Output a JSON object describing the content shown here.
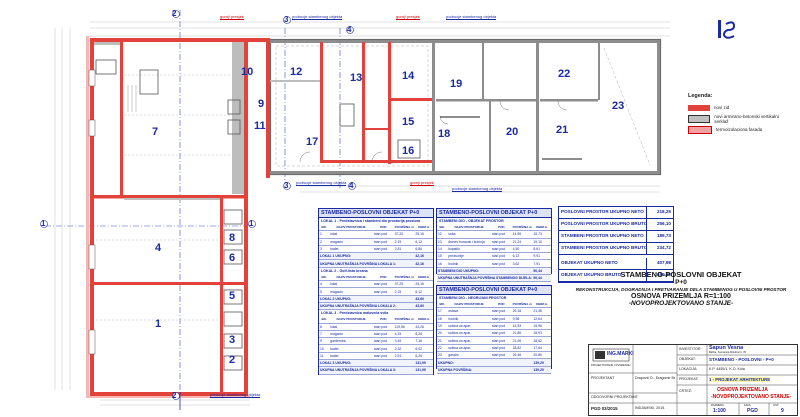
{
  "plan": {
    "rooms": [
      "1",
      "2",
      "3",
      "4",
      "5",
      "6",
      "7",
      "8",
      "9",
      "10",
      "11",
      "12",
      "13",
      "14",
      "15",
      "16",
      "17",
      "18",
      "19",
      "20",
      "21",
      "22",
      "23"
    ],
    "axis_labels": {
      "a2_top": "2",
      "a2_bottom": "2",
      "a1_left": "1",
      "a1_right": "1",
      "a3_top": "3",
      "a4_top": "4",
      "a3_mid": "3",
      "a4_mid": "4"
    },
    "tags": {
      "top1": "gornji presjek",
      "top2": "podrucje stambenog objekta",
      "top3": "gornji presjek",
      "top4": "podrucje stambenog objekta",
      "bot1": "podrucje stambenog objekta",
      "bot2": "gornji presjek",
      "bot3": "podrucje stambenog objekta",
      "left1": "podrucje stambenog objekta"
    }
  },
  "legend": {
    "title": "Legenda:",
    "items": [
      {
        "label": "novi zid",
        "color": "#e3423a"
      },
      {
        "label": "novi armirano-betonski vertikalni serklaž",
        "color": "#c0c0c0"
      },
      {
        "label": "termoizolaciona fasada",
        "color": "#f2a0a0"
      }
    ]
  },
  "tables": {
    "t1": {
      "title": "STAMBENO-POSLOVNI OBJEKAT P+0",
      "sections": [
        {
          "name": "LOKAL 1 - Predstavnica i stambeni dio prostorija prostora",
          "headers": [
            "BR.",
            "NAZIV PROSTORIJE",
            "POD",
            "POVRŠINA m²",
            "OBIM m"
          ],
          "rows": [
            [
              "1",
              "lokal",
              "stari pod",
              "37,20",
              "25,16"
            ],
            [
              "2",
              "magacin",
              "stari pod",
              "2,15",
              "6,12"
            ],
            [
              "3",
              "toalet",
              "stari pod",
              "2,81",
              "6,86"
            ]
          ],
          "sum": [
            "LOKAL 1 UKUPNO:",
            "42,16"
          ],
          "sum2": [
            "UKUPNA UNUTRAŠNJA POVRŠINA LOKALA 1:",
            "42,16"
          ]
        },
        {
          "name": "LOKAL 2 - Golf-lista kreana",
          "headers": [
            "BR.",
            "NAZIV PROSTORIJE",
            "POD",
            "POVRŠINA m²",
            "OBIM m"
          ],
          "rows": [
            [
              "4",
              "lokal",
              "stari pod",
              "37,29",
              "25,16"
            ],
            [
              "5",
              "magacin",
              "stari pod",
              "2,15",
              "6,12"
            ]
          ],
          "sum": [
            "LOKAL 2 UKUPNO:",
            "43,60"
          ],
          "sum2": [
            "UKUPNA UNUTRAŠNJA POVRŠINA LOKALA 2:",
            "43,60"
          ]
        },
        {
          "name": "LOKAL 3 - Predstavnica maloveća svila",
          "headers": [
            "BR.",
            "NAZIV PROSTORIJE",
            "POD",
            "POVRŠINA m²",
            "OBIM m"
          ],
          "rows": [
            [
              "6",
              "lokal",
              "stari pod",
              "119,56",
              "44,26"
            ],
            [
              "7",
              "magacin",
              "stari pod",
              "4,15",
              "8,26"
            ],
            [
              "9",
              "garderoba",
              "stari pod",
              "3,45",
              "7,16"
            ],
            [
              "10",
              "toalet",
              "stari pod",
              "2,32",
              "6,02"
            ],
            [
              "11",
              "toalet",
              "stari pod",
              "2,51",
              "6,26"
            ]
          ],
          "sum": [
            "LOKAL 3 UKUPNO:",
            "131,99"
          ],
          "sum2": [
            "UKUPNA UNUTRAŠNJA POVRŠINA LOKALA 3:",
            "131,99"
          ]
        }
      ]
    },
    "t2": {
      "title": "STAMBENO-POSLOVNI OBJEKAT P+0",
      "sections": [
        {
          "name": "STAMBENI DIO - OBJEKAT PROSTOR",
          "headers": [
            "BR.",
            "NAZIV PROSTORIJE",
            "POD",
            "POVRŠINA m²",
            "OBIM m"
          ],
          "rows": [
            [
              "12",
              "soba",
              "stari pod",
              "14,96",
              "15,73"
            ],
            [
              "13",
              "dnevni boravak i kuhinja",
              "stari pod",
              "21,24",
              "19,10"
            ],
            [
              "14",
              "kupatilo",
              "stari pod",
              "4,50",
              "8,61"
            ],
            [
              "15",
              "predsoblje",
              "stari pod",
              "6,12",
              "9,91"
            ],
            [
              "16",
              "hodnik",
              "stari pod",
              "3,62",
              "7,91"
            ]
          ],
          "sum": [
            "STAMBENI DIO UKUPNO:",
            "50,44"
          ],
          "sum2": [
            "UKUPNA UNUTRAŠNJA POVRŠINA STAMBENOG DIJELA:",
            "50,44"
          ]
        }
      ]
    },
    "t3": {
      "title": "STAMBENO-POSLOVNI OBJEKAT P+0",
      "sections": [
        {
          "name": "STAMBENI DIO - NEGRIJANI PROSTOR",
          "headers": [
            "BR.",
            "NAZIV PROSTORIJE",
            "POD",
            "POVRŠINA m²",
            "OBIM m"
          ],
          "rows": [
            [
              "17",
              "ostava",
              "stari pod",
              "26,18",
              "21,36"
            ],
            [
              "18",
              "hodnik",
              "stari pod",
              "9,98",
              "12,64"
            ],
            [
              "19",
              "sobica za apar.",
              "stari pod",
              "14,93",
              "15,96"
            ],
            [
              "20",
              "sobica za apar.",
              "stari pod",
              "21,86",
              "18,93"
            ],
            [
              "21",
              "sobica za apar.",
              "stari pod",
              "21,06",
              "18,62"
            ],
            [
              "22",
              "sobica za apar.",
              "stari pod",
              "18,82",
              "17,64"
            ],
            [
              "23",
              "garaža",
              "stari pod",
              "26,46",
              "20,86"
            ]
          ],
          "sum": [
            "UKUPNO:",
            "139,29"
          ],
          "sum2": [
            "UKUPNA POVRŠINA:",
            "139,29"
          ]
        }
      ]
    }
  },
  "summary": [
    {
      "label": "POSLOVNI PROSTOR UKUPNO NETO",
      "value": "218,25"
    },
    {
      "label": "POSLOVNI PROSTOR UKUPNO BRUTO",
      "value": "256,10"
    },
    {
      "label": "STAMBENI PROSTOR UKUPNO NETO",
      "value": "189,73"
    },
    {
      "label": "STAMBENI PROSTOR UKUPNO BRUTO",
      "value": "234,72"
    },
    {
      "label": "OBJEKAT UKUPNO NETO",
      "value": "407,98"
    },
    {
      "label": "OBJEKAT UKUPNO BRUTO",
      "value": "490,82"
    }
  ],
  "title_block": {
    "l1": "STAMBENO-POSLOVNI OBJEKAT",
    "l2": "P+0",
    "l3": "REKONSTRUKCIJA, DOGRADNJA I PRETVARANJE DELA STAMBENOG U POSLOVNI PROSTOR",
    "l4": "OSNOVA PRIZEMLJA R=1:100",
    "l5": "-NOVOPROJEKTOVANO STANJE-"
  },
  "stamp": {
    "company": "ING.MARKI",
    "company_sub": "PROJEKTOVANJE I IZVOĐENJE GRAĐEVINSKIH RADOVA",
    "investor_lbl": "INVESTITOR:",
    "investor": "Šapun Vesna",
    "investor_addr": "Bačka, Svetozara Miletića br. 35",
    "object_lbl": "OBJEKAT:",
    "object": "STAMBENO - POSLOVNI - P+0",
    "location_lbl": "LOKACIJA:",
    "location": "K.P. 4455/1, K.O. Kula",
    "project_lbl": "PROJEKAT:",
    "project": "1 - PROJEKAT ARHITEKTURE",
    "sheet_lbl": "CRTEŽ:",
    "sheet": "OSNOVA PRIZEMLJA",
    "sheet2": "-NOVOPROJEKTOVANO STANJE-",
    "scale_lbl": "RAZMERA:",
    "scale": "1:100",
    "phase_lbl": "FAZA:",
    "phase": "PGD",
    "page_lbl": "LIST:",
    "page": "9",
    "number": "PGD 03/2015",
    "date": "INDJAMSKI, 2015.",
    "designer": "Drapović D., Dragomir Branko",
    "designer_lbl": "PROJEKTANT",
    "responsible": "ODGOVORNI PROJEKTANT:"
  }
}
